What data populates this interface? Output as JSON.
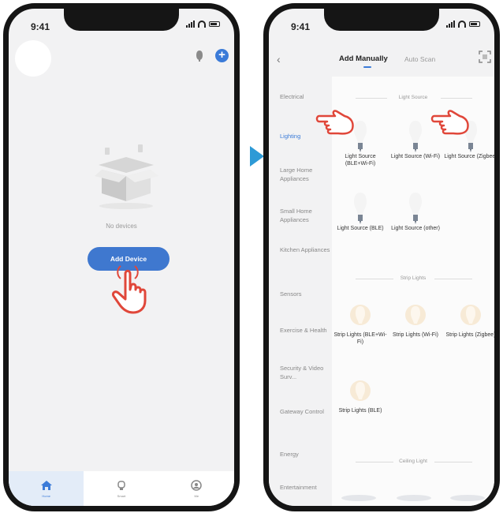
{
  "left_screen": {
    "status_time": "9:41",
    "empty_text": "No devices",
    "add_device_label": "Add Device",
    "tabs": [
      {
        "label": "Home",
        "icon": "home-icon",
        "active": true
      },
      {
        "label": "Smart",
        "icon": "smart-icon",
        "active": false
      },
      {
        "label": "Me",
        "icon": "me-icon",
        "active": false
      }
    ]
  },
  "right_screen": {
    "status_time": "9:41",
    "tab_manual": "Add Manually",
    "tab_auto": "Auto Scan",
    "categories": [
      "Electrical",
      "Lighting",
      "Large Home Appliances",
      "Small Home Appliances",
      "Kitchen Appliances",
      "Sensors",
      "Exercise & Health",
      "Security & Video Surv...",
      "Gateway Control",
      "Energy",
      "Entertainment"
    ],
    "active_category": "Lighting",
    "sections": [
      {
        "title": "Light Source",
        "items": [
          "Light Source (BLE+Wi-Fi)",
          "Light Source (Wi-Fi)",
          "Light Source (Zigbee)",
          "Light Source (BLE)",
          "Light Source (other)"
        ]
      },
      {
        "title": "Strip Lights",
        "items": [
          "Strip Lights (BLE+Wi-Fi)",
          "Strip Lights (Wi-Fi)",
          "Strip Lights (Zigbee)",
          "Strip Lights (BLE)"
        ]
      },
      {
        "title": "Ceiling Light",
        "items": []
      }
    ]
  },
  "colors": {
    "accent_blue": "#3f78cf",
    "arrow_blue": "#2d9ad6",
    "hand_red": "#e0473a"
  }
}
